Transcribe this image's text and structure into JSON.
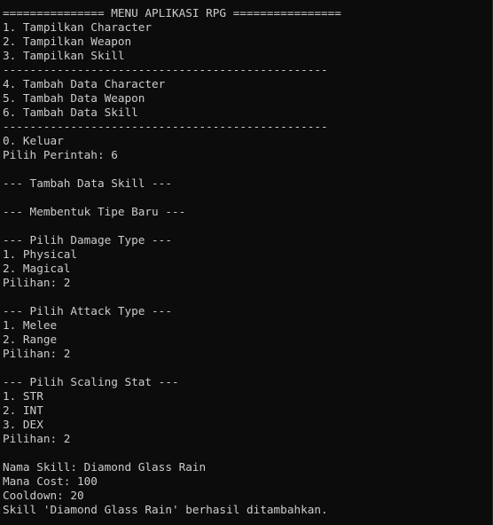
{
  "console": {
    "lines": [
      "=============== MENU APLIKASI RPG ================",
      "1. Tampilkan Character",
      "2. Tampilkan Weapon",
      "3. Tampilkan Skill",
      "------------------------------------------------",
      "4. Tambah Data Character",
      "5. Tambah Data Weapon",
      "6. Tambah Data Skill",
      "------------------------------------------------",
      "0. Keluar",
      "Pilih Perintah: 6",
      "",
      "--- Tambah Data Skill ---",
      "",
      "--- Membentuk Tipe Baru ---",
      "",
      "--- Pilih Damage Type ---",
      "1. Physical",
      "2. Magical",
      "Pilihan: 2",
      "",
      "--- Pilih Attack Type ---",
      "1. Melee",
      "2. Range",
      "Pilihan: 2",
      "",
      "--- Pilih Scaling Stat ---",
      "1. STR",
      "2. INT",
      "3. DEX",
      "Pilihan: 2",
      "",
      "Nama Skill: Diamond Glass Rain",
      "Mana Cost: 100",
      "Cooldown: 20",
      "Skill 'Diamond Glass Rain' berhasil ditambahkan."
    ]
  },
  "colors": {
    "background": "#0c0c0c",
    "text": "#cccccc"
  }
}
